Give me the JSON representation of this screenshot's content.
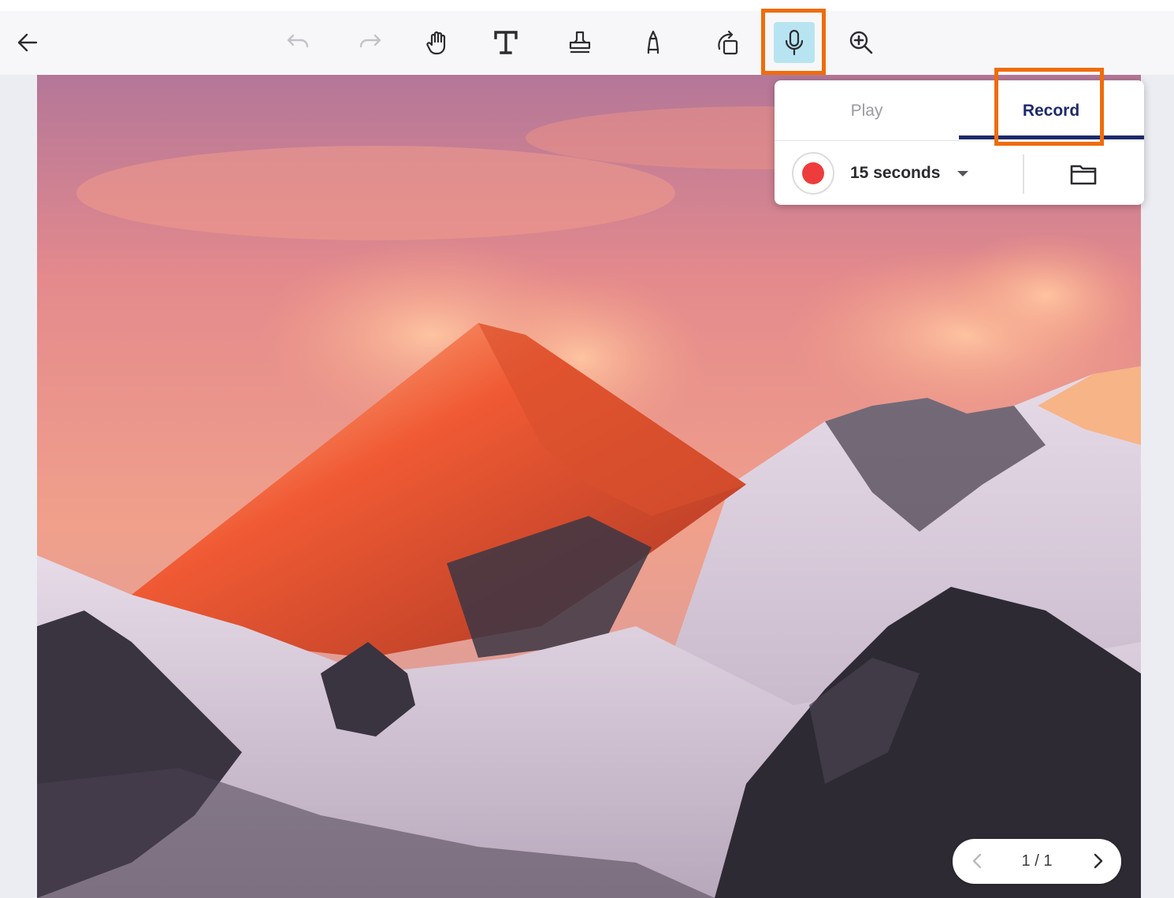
{
  "toolbar": {
    "tools": [
      {
        "icon": "back-arrow-icon",
        "enabled": true
      },
      {
        "icon": "undo-icon",
        "enabled": false
      },
      {
        "icon": "redo-icon",
        "enabled": false
      },
      {
        "icon": "hand-pan-icon",
        "enabled": true
      },
      {
        "icon": "text-tool-icon",
        "enabled": true
      },
      {
        "icon": "stamp-icon",
        "enabled": true
      },
      {
        "icon": "pen-icon",
        "enabled": true
      },
      {
        "icon": "rotate-icon",
        "enabled": true
      },
      {
        "icon": "microphone-icon",
        "enabled": true,
        "active": true
      },
      {
        "icon": "zoom-in-icon",
        "enabled": true
      }
    ],
    "active_bg": "#b8e4f1"
  },
  "audio_panel": {
    "tabs": [
      {
        "label": "Play",
        "selected": false
      },
      {
        "label": "Record",
        "selected": true
      }
    ],
    "duration": "15 seconds",
    "record_color": "#ee3c3c",
    "accent": "#1d2a6b"
  },
  "pager": {
    "label": "1 / 1"
  },
  "highlight_color": "#ef6c0a"
}
